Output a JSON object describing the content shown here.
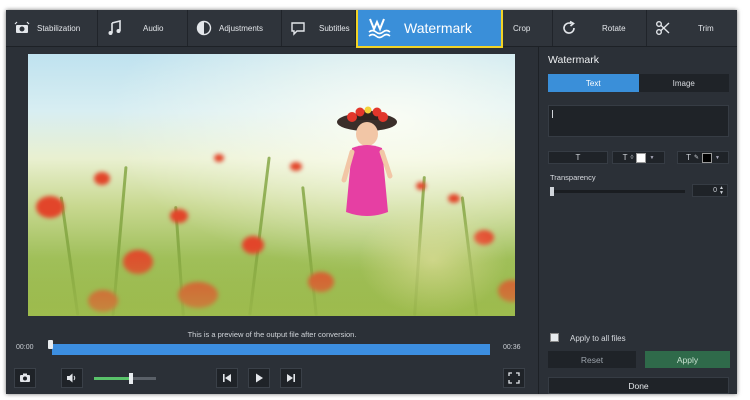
{
  "toolbar": {
    "items": [
      {
        "label": "Stabilization",
        "icon": "stabilization-icon"
      },
      {
        "label": "Audio",
        "icon": "music-note-icon"
      },
      {
        "label": "Adjustments",
        "icon": "adjustments-icon"
      },
      {
        "label": "Subtitles",
        "icon": "speech-bubble-icon"
      },
      {
        "label": "Watermark",
        "icon": "watermark-icon",
        "active": true
      },
      {
        "label": "Crop",
        "icon": "crop-icon"
      },
      {
        "label": "Rotate",
        "icon": "rotate-icon"
      },
      {
        "label": "Trim",
        "icon": "scissors-icon"
      }
    ],
    "highlight_color": "#3a8fd9",
    "highlight_border": "#f2d326"
  },
  "preview": {
    "caption": "This is a preview of the output file after conversion."
  },
  "timeline": {
    "start_time": "00:00",
    "end_time": "00:36",
    "position": 0.0
  },
  "controls": {
    "volume": 0.6
  },
  "panel": {
    "title": "Watermark",
    "tabs": [
      {
        "label": "Text",
        "selected": true
      },
      {
        "label": "Image",
        "selected": false
      }
    ],
    "text_value": "",
    "format_font_glyph": "T",
    "format_fill_glyph": "T",
    "format_outline_glyph": "T",
    "fill_color": "#ffffff",
    "outline_color": "#000000",
    "transparency_label": "Transparency",
    "transparency_value": "0",
    "apply_all_label": "Apply to all files",
    "reset_label": "Reset",
    "apply_label": "Apply",
    "done_label": "Done"
  }
}
